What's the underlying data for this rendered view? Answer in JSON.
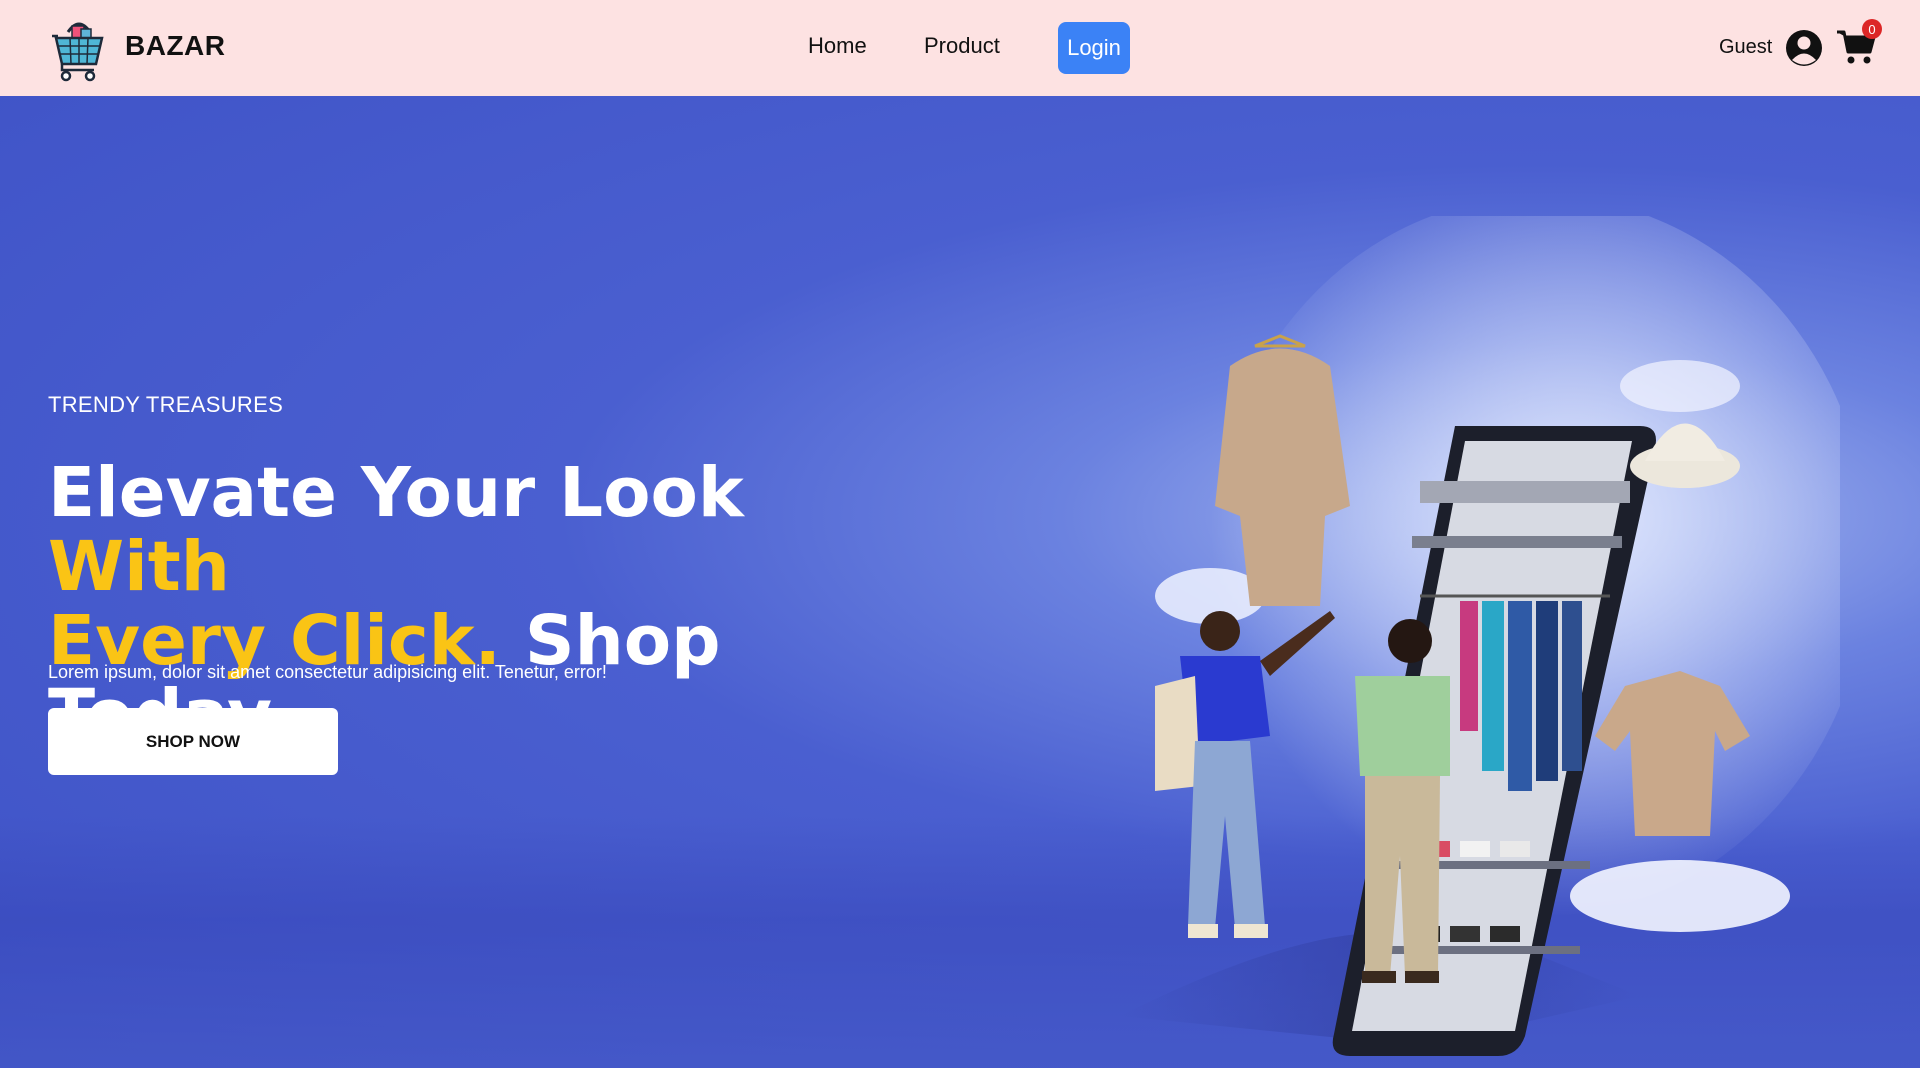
{
  "brand": {
    "name": "BAZAR",
    "logo_icon": "shopping-basket-icon"
  },
  "nav": {
    "links": [
      {
        "label": "Home"
      },
      {
        "label": "Product"
      }
    ],
    "login_label": "Login"
  },
  "user": {
    "name": "Guest",
    "avatar_icon": "user-circle-icon",
    "cart_icon": "shopping-cart-icon",
    "cart_count": "0"
  },
  "hero": {
    "eyebrow": "TRENDY TREASURES",
    "headline": {
      "part1": "Elevate Your Look ",
      "part2_accent": "With",
      "part3_accent": "Every Click.",
      "part4": " Shop Today"
    },
    "subtext": "Lorem ipsum, dolor sit amet consectetur adipisicing elit. Tenetur, error!",
    "cta_label": "SHOP NOW"
  },
  "colors": {
    "nav_bg": "#fde2e2",
    "hero_bg": "#3e52c6",
    "accent_yellow": "#fac415",
    "login_blue": "#3b82f6",
    "badge_red": "#dc2626"
  }
}
